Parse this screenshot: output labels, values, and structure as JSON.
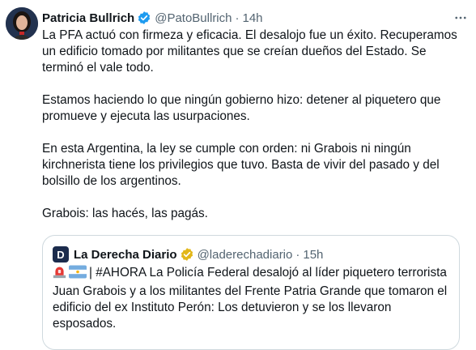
{
  "tweet": {
    "author_name": "Patricia Bullrich",
    "handle": "@PatoBullrich",
    "separator": "·",
    "time": "14h",
    "paragraphs": [
      "La PFA actuó con firmeza y eficacia. El desalojo fue un éxito. Recuperamos un edificio tomado por militantes que se creían dueños del Estado. Se terminó el vale todo.",
      "Estamos haciendo lo que ningún gobierno hizo: detener al piquetero que promueve y ejecuta las usurpaciones.",
      "En esta Argentina, la ley se cumple con orden: ni Grabois ni ningún kirchnerista tiene los privilegios que tuvo. Basta de vivir del pasado y del bolsillo de los argentinos.",
      "Grabois: las hacés, las pagás."
    ]
  },
  "quote": {
    "avatar_letter": "D",
    "author_name": "La Derecha Diario",
    "handle": "@laderechadiario",
    "separator": "·",
    "time": "15h",
    "text": "| #AHORA La Policía Federal desalojó al líder piquetero terrorista Juan Grabois y a los militantes del Frente Patria Grande que tomaron el edificio del ex Instituto Perón: Los detuvieron y se los llevaron esposados."
  },
  "colors": {
    "verified_blue": "#1d9bf0",
    "verified_gold": "#e2b719",
    "secondary_text": "#536471",
    "border": "#cfd9de"
  },
  "icons": {
    "verified": "verified-badge-icon",
    "gold": "gold-verified-badge-icon",
    "more": "more-options-icon",
    "siren": "siren-emoji-icon",
    "flag": "argentina-flag-emoji-icon"
  }
}
